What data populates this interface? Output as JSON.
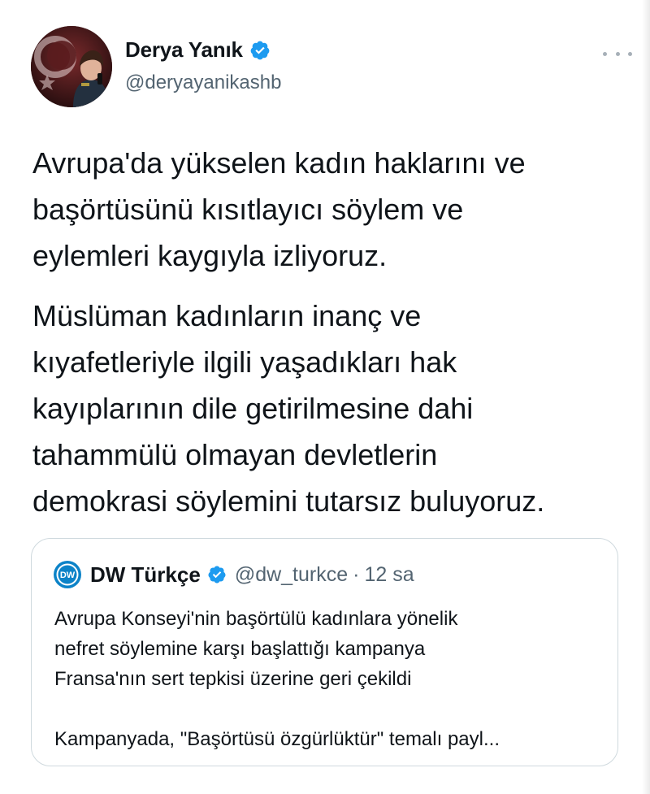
{
  "author": {
    "display_name": "Derya Yanık",
    "handle": "@deryayanikashb",
    "verified_icon": "verified-badge-icon",
    "more_icon": "more-dots-icon"
  },
  "tweet": {
    "paragraphs": [
      [
        "Avrupa'da yükselen kadın haklarını ve",
        "başörtüsünü kısıtlayıcı söylem ve",
        "eylemleri kaygıyla izliyoruz."
      ],
      [
        "Müslüman kadınların inanç ve",
        "kıyafetleriyle ilgili yaşadıkları hak",
        "kayıplarının dile getirilmesine dahi",
        "tahammülü olmayan devletlerin",
        "demokrasi söylemini tutarsız buluyoruz."
      ]
    ]
  },
  "quoted": {
    "display_name": "DW Türkçe",
    "handle": "@dw_turkce",
    "separator": "·",
    "time": "12 sa",
    "logo_text": "DW",
    "lines": [
      "Avrupa Konseyi'nin başörtülü kadınlara yönelik",
      "nefret söylemine karşı başlattığı kampanya",
      "Fransa'nın sert tepkisi üzerine geri çekildi",
      "",
      "Kampanyada, \"Başörtüsü özgürlüktür\" temalı payl..."
    ]
  },
  "colors": {
    "verified_blue": "#1d9bf0",
    "text_primary": "#0f1419",
    "text_secondary": "#536471",
    "border": "#cfd9de",
    "dw_blue": "#0c83c8"
  }
}
